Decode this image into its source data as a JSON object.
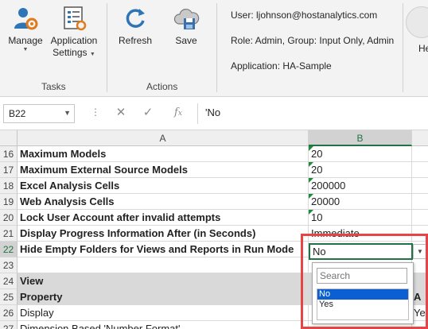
{
  "ribbon": {
    "tasks_group": {
      "label": "Tasks",
      "buttons": [
        {
          "label": "Manage",
          "icon": "user-gear-icon",
          "has_menu": true
        },
        {
          "label_line1": "Application",
          "label_line2": "Settings",
          "icon": "application-settings-icon",
          "has_menu": true
        }
      ]
    },
    "actions_group": {
      "label": "Actions",
      "buttons": [
        {
          "label": "Refresh",
          "icon": "refresh-icon"
        },
        {
          "label": "Save",
          "icon": "cloud-save-icon"
        }
      ]
    },
    "info": {
      "user": "User: ljohnson@hostanalytics.com",
      "role": "Role: Admin, Group: Input Only, Admin",
      "application": "Application: HA-Sample"
    },
    "help_partial": "He"
  },
  "formula_bar": {
    "name_box": "B22",
    "formula": "'No",
    "cancel_icon": "close-icon",
    "enter_icon": "check-icon",
    "function_icon": "fx-icon"
  },
  "grid": {
    "columns": [
      "A",
      "B"
    ],
    "selected_column": "B",
    "rows": [
      {
        "num": "16",
        "a": "Maximum Models",
        "b": "20",
        "bold": true,
        "flag": true
      },
      {
        "num": "17",
        "a": "Maximum External Source Models",
        "b": "20",
        "bold": true,
        "flag": true
      },
      {
        "num": "18",
        "a": "Excel Analysis Cells",
        "b": "200000",
        "bold": true,
        "flag": true
      },
      {
        "num": "19",
        "a": "Web Analysis Cells",
        "b": "20000",
        "bold": true,
        "flag": true
      },
      {
        "num": "20",
        "a": "Lock User Account after invalid attempts",
        "b": "10",
        "bold": true,
        "flag": true
      },
      {
        "num": "21",
        "a": "Display Progress Information After (in Seconds)",
        "b": "Immediate",
        "bold": true,
        "flag": false
      },
      {
        "num": "22",
        "a": "Hide Empty Folders for Views and Reports in Run Mode",
        "b": "No",
        "bold": true,
        "flag": false
      },
      {
        "num": "23",
        "a": "",
        "b": "",
        "bold": false,
        "flag": false
      },
      {
        "num": "24",
        "a": "View",
        "b": "",
        "bold": true,
        "flag": false,
        "shaded": true
      },
      {
        "num": "25",
        "a": "Property",
        "b": "",
        "c": "A",
        "bold": true,
        "flag": false,
        "shaded": true
      },
      {
        "num": "26",
        "a": "Display",
        "b": "",
        "c": "Ye",
        "bold": false,
        "flag": false
      },
      {
        "num": "27",
        "a": "Dimension Based 'Number Format'",
        "b": "",
        "bold": false,
        "flag": false
      }
    ],
    "active_cell": {
      "ref": "B22",
      "value": "No"
    }
  },
  "dropdown": {
    "search_placeholder": "Search",
    "options": [
      {
        "label": "No",
        "selected": true
      },
      {
        "label": "Yes",
        "selected": false
      }
    ]
  },
  "colors": {
    "excel_green": "#217346",
    "highlight_red": "#e64545",
    "selection_blue": "#0a60d2",
    "icon_blue": "#2e75b6"
  }
}
